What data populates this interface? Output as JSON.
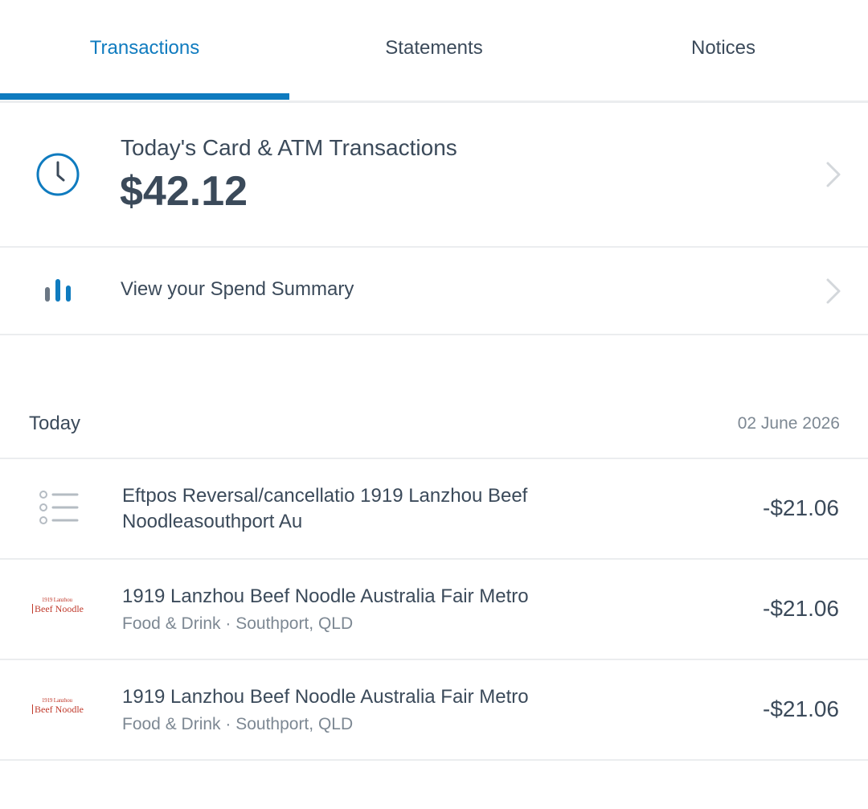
{
  "tabs": [
    {
      "label": "Transactions",
      "active": true
    },
    {
      "label": "Statements",
      "active": false
    },
    {
      "label": "Notices",
      "active": false
    }
  ],
  "card_summary": {
    "title": "Today's Card & ATM Transactions",
    "amount": "$42.12",
    "icon": "clock-icon"
  },
  "spend_summary": {
    "label": "View your Spend Summary",
    "icon": "bar-chart-icon"
  },
  "date_group": {
    "label": "Today",
    "date": "02 June 2026"
  },
  "transactions": [
    {
      "description": "Eftpos Reversal/cancellatio 1919 Lanzhou Beef Noodleasouthport Au",
      "subtitle": "",
      "amount": "-$21.06",
      "icon": "list-icon"
    },
    {
      "description": "1919 Lanzhou Beef Noodle Australia Fair Metro",
      "subtitle": "Food & Drink · Southport, QLD",
      "amount": "-$21.06",
      "icon": "merchant-logo"
    },
    {
      "description": "1919 Lanzhou Beef Noodle Australia Fair Metro",
      "subtitle": "Food & Drink · Southport, QLD",
      "amount": "-$21.06",
      "icon": "merchant-logo"
    }
  ],
  "merchant_logo": {
    "top_text": "1919 Lanzhou",
    "bottom_text": "Beef Noodle"
  },
  "colors": {
    "accent": "#0f7bbf",
    "text": "#3b4a5a",
    "muted": "#7d8893",
    "divider": "#ebedef",
    "logo": "#c0392b"
  }
}
